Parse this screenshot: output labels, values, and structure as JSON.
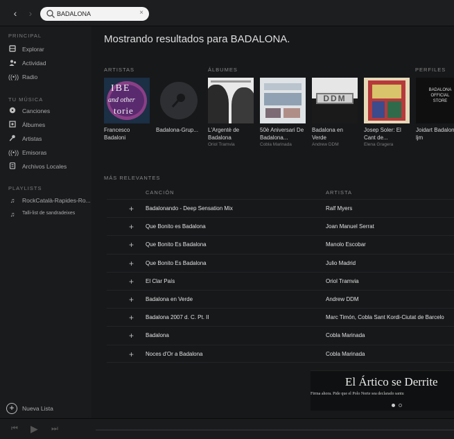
{
  "search": {
    "value": "BADALONA",
    "clear": "×"
  },
  "nav": {
    "back": "‹",
    "forward": "›"
  },
  "sidebar": {
    "principal_heading": "PRINCIPAL",
    "principal": [
      {
        "label": "Explorar",
        "icon": "browse-icon"
      },
      {
        "label": "Actividad",
        "icon": "activity-icon"
      },
      {
        "label": "Radio",
        "icon": "radio-icon"
      }
    ],
    "music_heading": "TU MÚSICA",
    "music": [
      {
        "label": "Canciones",
        "icon": "songs-icon"
      },
      {
        "label": "Álbumes",
        "icon": "albums-icon"
      },
      {
        "label": "Artistas",
        "icon": "artists-icon"
      },
      {
        "label": "Emisoras",
        "icon": "stations-icon"
      },
      {
        "label": "Archivos Locales",
        "icon": "local-files-icon"
      }
    ],
    "playlists_heading": "PLAYLISTS",
    "playlists": [
      {
        "label": "RockCatalà-Rapides-Ro...",
        "icon": "playlist-note-icon"
      },
      {
        "label": "Talli-list de sandradeixes",
        "icon": "playlist-note-icon"
      }
    ],
    "new_list": "Nueva Lista"
  },
  "main": {
    "title": "Mostrando resultados para BADALONA.",
    "artists_heading": "ARTISTAS",
    "albums_heading": "ÁLBUMES",
    "profiles_heading": "PERFILES",
    "cards": [
      {
        "name": "Francesco Badaloni",
        "sub": "",
        "art_text": [
          "IBE",
          "and other",
          "torie"
        ]
      },
      {
        "name": "Badalona-Grup...",
        "sub": "",
        "art_text": []
      },
      {
        "name": "L'Argentè de Badalona",
        "sub": "Oriol Tramvia",
        "art_text": []
      },
      {
        "name": "50è Aniversari De Badalona...",
        "sub": "Cobla Marinada",
        "art_text": []
      },
      {
        "name": "Badalona en Verde",
        "sub": "Andrew DDM",
        "art_text": [
          "DDM"
        ]
      },
      {
        "name": "Josep Soler: El Cant de...",
        "sub": "Elena Gragera",
        "art_text": []
      },
      {
        "name": "Joidart Badalona ljm",
        "sub": "",
        "art_text": [
          "BADALONA",
          "OFFICIAL",
          "STORE"
        ]
      }
    ],
    "relevant_heading": "MÁS RELEVANTES",
    "col_song": "CANCIÓN",
    "col_artist": "ARTISTA",
    "tracks": [
      {
        "song": "Badalonando - Deep Sensation Mix",
        "artist": "Ralf Myers"
      },
      {
        "song": "Que Bonito es Badalona",
        "artist": "Joan Manuel Serrat"
      },
      {
        "song": "Que Bonito Es Badalona",
        "artist": "Manolo Escobar"
      },
      {
        "song": "Que Bonito Es Badalona",
        "artist": "Julio Madrid"
      },
      {
        "song": "El Clar País",
        "artist": "Oriol Tramvia"
      },
      {
        "song": "Badalona en Verde",
        "artist": "Andrew DDM"
      },
      {
        "song": "Badalona 2007 d. C. Pt. II",
        "artist": "Marc Timón, Cobla Sant Kordi-Ciutat de Barcelo"
      },
      {
        "song": "Badalona",
        "artist": "Cobla Marinada"
      },
      {
        "song": "Noces d'Or a Badalona",
        "artist": "Cobla Marinada"
      }
    ],
    "ad": {
      "title": "El Ártico se Derrite",
      "text": "Firma ahora. Pide que el Polo Norte sea declarado santu"
    }
  },
  "colors": {
    "background": "#121314",
    "sidebar": "#1a1b1d",
    "main": "#17181a",
    "text": "#e1e1e1"
  }
}
